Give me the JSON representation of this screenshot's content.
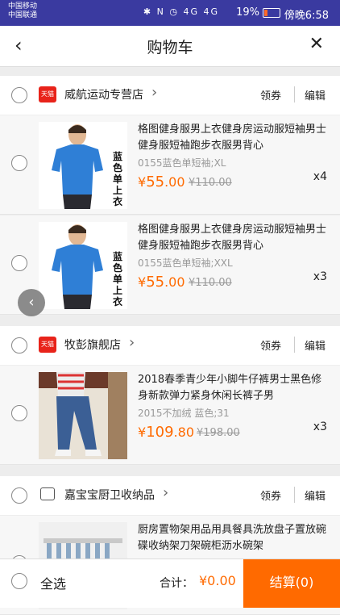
{
  "status": {
    "carrier1": "中国移动",
    "carrier2": "中国联通",
    "icons": "✱ N ◷ 4G 4G",
    "battery": "19%",
    "time": "傍晚6:58"
  },
  "nav": {
    "title": "购物车",
    "back": "‹",
    "close": "✕"
  },
  "shops": [
    {
      "name": "威航运动专营店",
      "badge": "天猫",
      "coupon": "领券",
      "edit": "编辑",
      "items": [
        {
          "title": "格图健身服男上衣健身房运动服短袖男士健身服短袖跑步衣服男背心",
          "sku": "0155蓝色单短袖;XL",
          "price_int": "55",
          "price_dec": ".00",
          "old": "¥110.00",
          "qty": "x4",
          "side": "蓝色单上衣"
        },
        {
          "title": "格图健身服男上衣健身房运动服短袖男士健身服短袖跑步衣服男背心",
          "sku": "0155蓝色单短袖;XXL",
          "price_int": "55",
          "price_dec": ".00",
          "old": "¥110.00",
          "qty": "x3",
          "side": "蓝色单上衣"
        }
      ]
    },
    {
      "name": "牧彭旗舰店",
      "badge": "天猫",
      "coupon": "领券",
      "edit": "编辑",
      "items": [
        {
          "title": "2018春季青少年小脚牛仔裤男士黑色修身新款弹力紧身休闲长裤子男",
          "sku": "2015不加绒 蓝色;31",
          "price_int": "109",
          "price_dec": ".80",
          "old": "¥198.00",
          "qty": "x3"
        }
      ]
    },
    {
      "name": "嘉宝宝厨卫收纳品",
      "coupon": "领券",
      "edit": "编辑",
      "items": [
        {
          "title": "厨房置物架用品用具餐具洗放盘子置放碗碟收纳架刀架碗柜沥水碗架"
        }
      ]
    }
  ],
  "currency": "¥",
  "bottom": {
    "select_all": "全选",
    "total_label": "合计：",
    "total_value": "¥0.00",
    "checkout": "结算(0)"
  },
  "colors": {
    "accent": "#ff6a00",
    "status_bar": "#3a3aa0",
    "tmall_red": "#e8231a"
  }
}
